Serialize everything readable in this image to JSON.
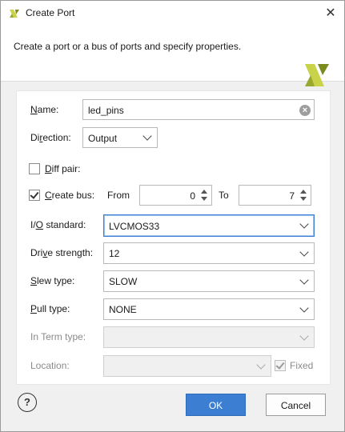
{
  "window": {
    "title": "Create Port",
    "close_glyph": "✕",
    "icon": "vivado-logo-icon"
  },
  "banner": {
    "description": "Create a port or a bus of ports and specify properties.",
    "logo": "vivado-logo-icon"
  },
  "form": {
    "name": {
      "label_pre": "",
      "label_key": "N",
      "label_post": "ame:",
      "value": "led_pins"
    },
    "direction": {
      "label_pre": "Di",
      "label_key": "r",
      "label_post": "ection:",
      "value": "Output"
    },
    "diff_pair": {
      "label_pre": "",
      "label_key": "D",
      "label_post": "iff pair:",
      "checked": false
    },
    "create_bus": {
      "label_pre": "",
      "label_key": "C",
      "label_post": "reate bus:",
      "checked": true,
      "from_label": "From",
      "from_value": "0",
      "to_label": "To",
      "to_value": "7"
    },
    "io_standard": {
      "label_pre": "I/",
      "label_key": "O",
      "label_post": " standard:",
      "value": "LVCMOS33"
    },
    "drive_strength": {
      "label_pre": "Dri",
      "label_key": "v",
      "label_post": "e strength:",
      "value": "12"
    },
    "slew_type": {
      "label_pre": "",
      "label_key": "S",
      "label_post": "lew type:",
      "value": "SLOW"
    },
    "pull_type": {
      "label_pre": "",
      "label_key": "P",
      "label_post": "ull type:",
      "value": "NONE"
    },
    "in_term_type": {
      "label": "In Term type:",
      "value": ""
    },
    "location": {
      "label": "Location:",
      "value": "",
      "fixed_label": "Fixed",
      "fixed_checked": true
    }
  },
  "footer": {
    "help_glyph": "?",
    "ok_label": "OK",
    "cancel_label": "Cancel"
  },
  "colors": {
    "accent": "#3c7fd2",
    "logo_light": "#c9d34a",
    "logo_dark": "#7a8a1c"
  }
}
